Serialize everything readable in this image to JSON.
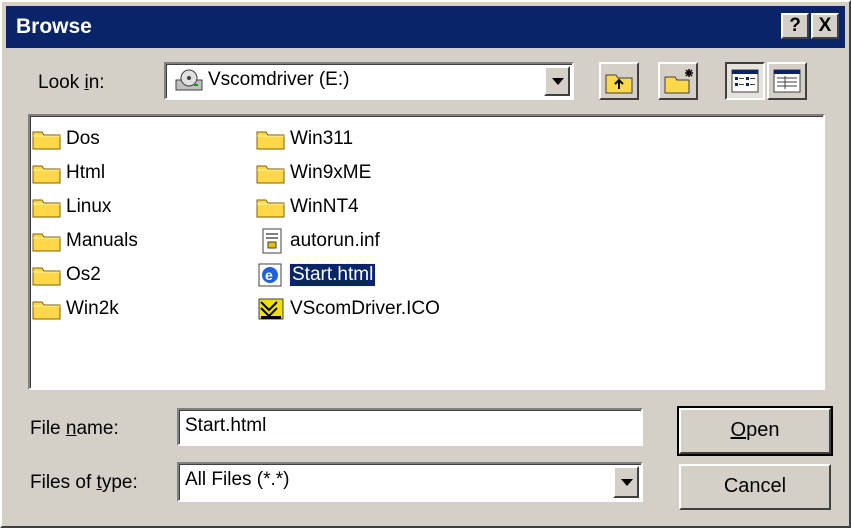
{
  "window": {
    "title": "Browse"
  },
  "titlebar": {
    "help_label": "?",
    "close_label": "X"
  },
  "look_in": {
    "label_pre": "Look ",
    "label_u": "i",
    "label_post": "n:",
    "value": "Vscomdriver (E:)"
  },
  "toolbar": {
    "icons": [
      "up-one-level-icon",
      "create-new-folder-icon",
      "list-view-icon",
      "details-view-icon"
    ]
  },
  "files": {
    "col1": [
      {
        "name": "Dos",
        "type": "folder"
      },
      {
        "name": "Html",
        "type": "folder"
      },
      {
        "name": "Linux",
        "type": "folder"
      },
      {
        "name": "Manuals",
        "type": "folder"
      },
      {
        "name": "Os2",
        "type": "folder"
      },
      {
        "name": "Win2k",
        "type": "folder"
      }
    ],
    "col2": [
      {
        "name": "Win311",
        "type": "folder"
      },
      {
        "name": "Win9xME",
        "type": "folder"
      },
      {
        "name": "WinNT4",
        "type": "folder"
      },
      {
        "name": "autorun.inf",
        "type": "inf-file"
      },
      {
        "name": "Start.html",
        "type": "html-file",
        "selected": true
      },
      {
        "name": "VScomDriver.ICO",
        "type": "ico-file"
      }
    ]
  },
  "file_name": {
    "label_pre": "File ",
    "label_u": "n",
    "label_post": "ame:",
    "value": "Start.html"
  },
  "file_type": {
    "label_pre": "Files of ",
    "label_u": "t",
    "label_post": "ype:",
    "value": "All Files (*.*)"
  },
  "buttons": {
    "open_u": "O",
    "open_rest": "pen",
    "cancel": "Cancel"
  },
  "colors": {
    "titlebar": "#0a246a",
    "face": "#d4d0c8",
    "folder": "#ffd84a",
    "selection": "#0a246a"
  }
}
